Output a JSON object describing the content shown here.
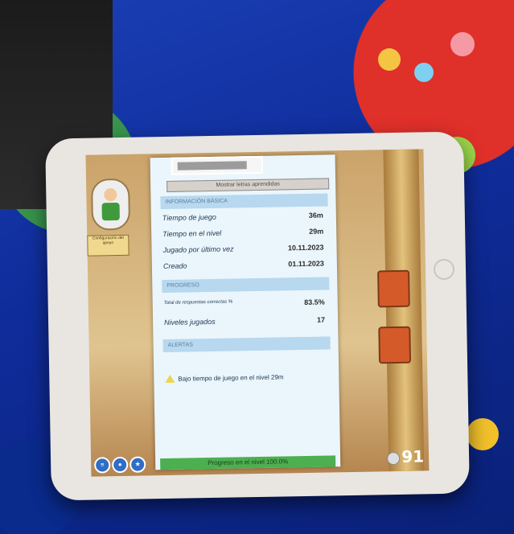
{
  "app": {
    "menu_label": "Mostrar letras aprendidas",
    "parent_button": "Configuración del apoyo",
    "score": "91",
    "colors": {
      "panel_bg": "#eaf6fc",
      "section_bg": "#b7d8ee",
      "progress": "#4caf50",
      "bezel": "#e9e6e1"
    }
  },
  "panel": {
    "sections": [
      {
        "title": "INFORMACIÓN BÁSICA",
        "rows": [
          {
            "label": "Tiempo de juego",
            "value": "36m"
          },
          {
            "label": "Tiempo en el nivel",
            "value": "29m"
          },
          {
            "label": "Jugado por último vez",
            "value": "10.11.2023"
          },
          {
            "label": "Creado",
            "value": "01.11.2023"
          }
        ]
      },
      {
        "title": "PROGRESO",
        "rows": [
          {
            "label": "Total de respuestas correctas %",
            "value": "83.5%"
          },
          {
            "label": "Niveles jugados",
            "value": "17"
          }
        ]
      },
      {
        "title": "ALERTAS",
        "alert": "Bajo tiempo de juego en el nivel 29m"
      }
    ],
    "progress": {
      "label": "Progreso en el nivel 100.0%",
      "value": 1.0
    }
  },
  "icons": [
    "menu-icon",
    "character-icon",
    "ribbon-icon",
    "coin-icon",
    "warning-icon",
    "home-button-icon"
  ]
}
